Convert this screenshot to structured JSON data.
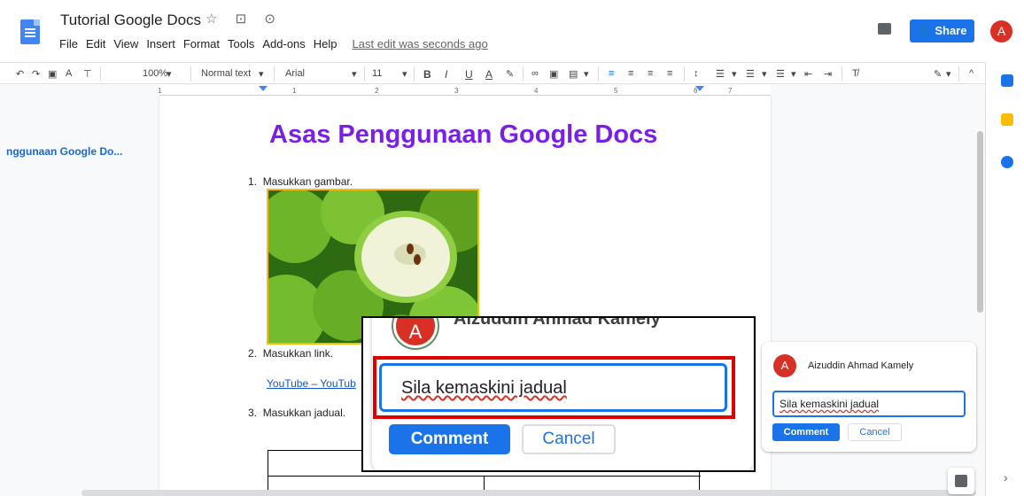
{
  "header": {
    "doc_title": "Tutorial Google Docs",
    "title_icons": "☆ ⊡ ⊙",
    "menu": [
      "File",
      "Edit",
      "View",
      "Insert",
      "Format",
      "Tools",
      "Add-ons",
      "Help"
    ],
    "last_edit": "Last edit was seconds ago",
    "share_label": "Share",
    "avatar_initial": "A"
  },
  "toolbar": {
    "zoom": "100%",
    "style": "Normal text",
    "font": "Arial",
    "font_size": "11",
    "bold": "B",
    "italic": "I",
    "underline": "U",
    "text_color": "A"
  },
  "ruler": {
    "ticks": [
      "1",
      "1",
      "2",
      "3",
      "4",
      "5",
      "6",
      "7"
    ]
  },
  "outline": {
    "item": "nggunaan Google Do..."
  },
  "document": {
    "heading": "Asas Penggunaan Google Docs",
    "items": [
      {
        "num": "1.",
        "text": "Masukkan gambar."
      },
      {
        "num": "2.",
        "text": "Masukkan link."
      },
      {
        "num": "3.",
        "text": "Masukkan jadual."
      }
    ],
    "link_text": "YouTube – YouTub"
  },
  "comment_card": {
    "avatar_initial": "A",
    "author": "Aizuddin Ahmad Kamely",
    "input_value": "Sila kemaskini jadual",
    "comment_label": "Comment",
    "cancel_label": "Cancel"
  },
  "zoom_overlay": {
    "avatar_initial": "A",
    "author": "Aizuddin Ahmad Kamely",
    "input_value": "Sila kemaskini jadual",
    "comment_label": "Comment",
    "cancel_label": "Cancel"
  },
  "colors": {
    "accent": "#1a73e8",
    "heading": "#7a1fe6",
    "highlight": "#e00000",
    "avatar": "#d93025"
  }
}
